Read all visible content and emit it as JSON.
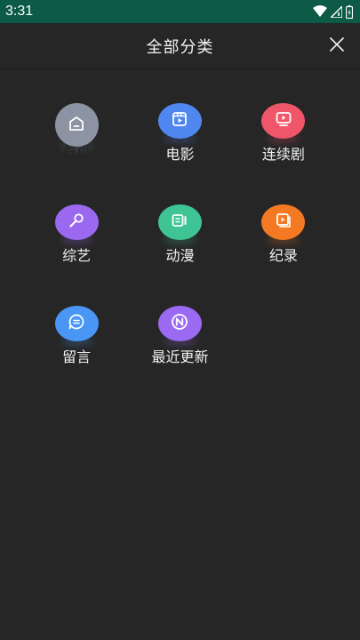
{
  "status_bar": {
    "time": "3:31"
  },
  "header": {
    "title": "全部分类"
  },
  "categories": [
    {
      "label": "首页",
      "icon": "home-icon",
      "color": "#8c93a3"
    },
    {
      "label": "电影",
      "icon": "film-icon",
      "color": "#4f86f0"
    },
    {
      "label": "连续剧",
      "icon": "tv-icon",
      "color": "#f0566a"
    },
    {
      "label": "综艺",
      "icon": "microphone-icon",
      "color": "#9a69f0"
    },
    {
      "label": "动漫",
      "icon": "animation-icon",
      "color": "#3ec495"
    },
    {
      "label": "纪录",
      "icon": "play-document-icon",
      "color": "#f37a23"
    },
    {
      "label": "留言",
      "icon": "message-icon",
      "color": "#4a96f5"
    },
    {
      "label": "最近更新",
      "icon": "new-badge-icon",
      "color": "#9a6af2"
    }
  ]
}
